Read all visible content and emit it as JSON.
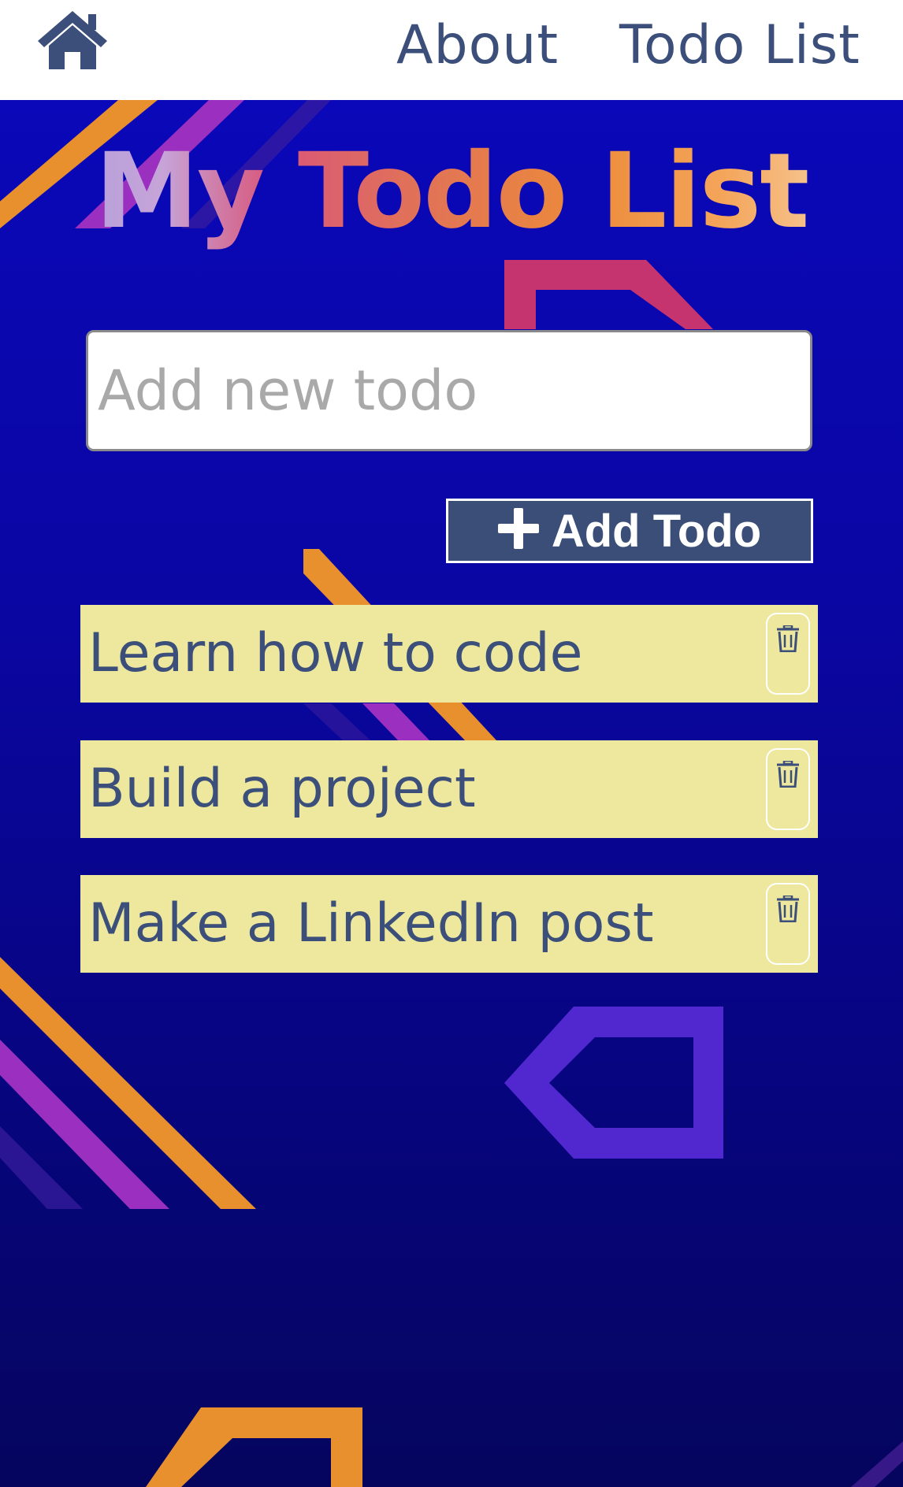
{
  "nav": {
    "home_icon": "home-icon",
    "about": "About",
    "todo_list": "Todo List"
  },
  "title": "My Todo List",
  "input": {
    "placeholder": "Add new todo",
    "value": ""
  },
  "add_button": {
    "icon": "plus-icon",
    "label": "Add Todo"
  },
  "todos": [
    {
      "text": "Learn how to code",
      "delete_icon": "trash-icon"
    },
    {
      "text": "Build a project",
      "delete_icon": "trash-icon"
    },
    {
      "text": "Make a LinkedIn post",
      "delete_icon": "trash-icon"
    }
  ],
  "colors": {
    "nav_text": "#3b4f7a",
    "button_bg": "#3a4e78",
    "todo_bg": "#ede89d",
    "background": "#0a06a4"
  }
}
